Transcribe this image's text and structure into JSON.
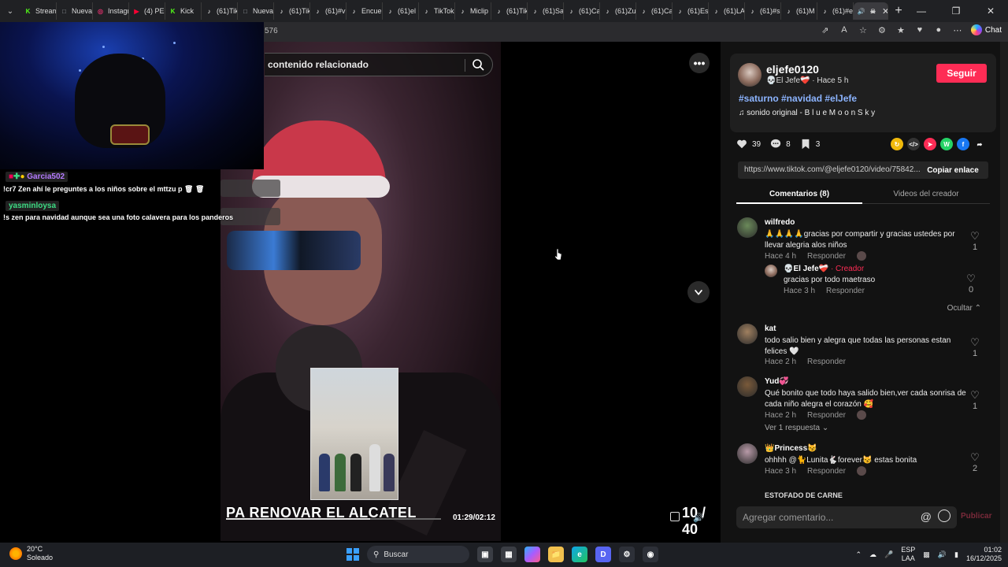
{
  "browser": {
    "tabs": [
      {
        "label": "Stream",
        "icon": "kick-icon",
        "color": "#53fc18"
      },
      {
        "label": "Nueva",
        "icon": "page-icon",
        "color": "#9aa0a6"
      },
      {
        "label": "Instagr",
        "icon": "instagram-icon",
        "color": "#e1306c"
      },
      {
        "label": "(4) PER",
        "icon": "youtube-icon",
        "color": "#ff0033"
      },
      {
        "label": "Kick",
        "icon": "kick-icon",
        "color": "#53fc18"
      },
      {
        "label": "(61)Tik",
        "icon": "tiktok-icon",
        "color": "#ffffff"
      },
      {
        "label": "Nueva",
        "icon": "page-icon",
        "color": "#9aa0a6"
      },
      {
        "label": "(61)Tik",
        "icon": "tiktok-icon",
        "color": "#ffffff"
      },
      {
        "label": "(61)#v",
        "icon": "tiktok-icon",
        "color": "#ffffff"
      },
      {
        "label": "Encue",
        "icon": "tiktok-icon",
        "color": "#ffffff"
      },
      {
        "label": "(61)el",
        "icon": "tiktok-icon",
        "color": "#ffffff"
      },
      {
        "label": "TikTok",
        "icon": "tiktok-icon",
        "color": "#ffffff"
      },
      {
        "label": "Miclip",
        "icon": "tiktok-icon",
        "color": "#ffffff"
      },
      {
        "label": "(61)Tik",
        "icon": "tiktok-icon",
        "color": "#ffffff"
      },
      {
        "label": "(61)Sa",
        "icon": "tiktok-icon",
        "color": "#ffffff"
      },
      {
        "label": "(61)Ca",
        "icon": "tiktok-icon",
        "color": "#ffffff"
      },
      {
        "label": "(61)Zu",
        "icon": "tiktok-icon",
        "color": "#ffffff"
      },
      {
        "label": "(61)Ca",
        "icon": "tiktok-icon",
        "color": "#ffffff"
      },
      {
        "label": "(61)Es",
        "icon": "tiktok-icon",
        "color": "#ffffff"
      },
      {
        "label": "(61)LA",
        "icon": "tiktok-icon",
        "color": "#ffffff"
      },
      {
        "label": "(61)#s",
        "icon": "tiktok-icon",
        "color": "#ffffff"
      },
      {
        "label": "(61)M",
        "icon": "tiktok-icon",
        "color": "#ffffff"
      },
      {
        "label": "(61)#e",
        "icon": "tiktok-icon",
        "color": "#ffffff"
      }
    ],
    "url_fragment": "576",
    "chat_label": "Chat"
  },
  "stream_overlay": {
    "chat": [
      {
        "user": "Garcia502",
        "user_color": "#b57bff",
        "text": "!cr7 Zen ahí le preguntes a los niños sobre el mttzu p 🗑 🗑"
      },
      {
        "user": "yasminloysa",
        "user_color": "#3ddc84",
        "text": "!s zen para navidad aunque sea una foto calavera para los panderos"
      }
    ]
  },
  "video": {
    "search_placeholder": "contenido relacionado",
    "caption": "PA RENOVAR EL ALCATEL",
    "time": "01:29/02:12",
    "progress": 0.67,
    "counter": "10 / 40",
    "overlay_progress": 0.24
  },
  "creator": {
    "handle": "eljefe0120",
    "nickname": "💀El Jefe❤️‍🩹",
    "time_ago": "Hace 5 h",
    "follow_label": "Seguir",
    "hashtags": "#saturno #navidad #elJefe",
    "music": "sonido original - B l u e M o o n S k y"
  },
  "stats": {
    "likes": "39",
    "comments": "8",
    "saves": "3"
  },
  "link": {
    "url": "https://www.tiktok.com/@eljefe0120/video/75842...",
    "copy_label": "Copiar enlace"
  },
  "panel_tabs": {
    "comments": "Comentarios (8)",
    "creator_videos": "Videos del creador"
  },
  "comments": [
    {
      "user": "wilfredo",
      "text": "🙏🙏🙏🙏gracias por compartir y gracias ustedes por llevar alegria alos niños",
      "time": "Hace 4 h",
      "reply_label": "Responder",
      "likes": "1",
      "avatar_color": "#6b8a5a"
    },
    {
      "user": "kat",
      "text": "todo salio bien y alegra que todas las personas estan felices 🤍",
      "time": "Hace 2 h",
      "reply_label": "Responder",
      "likes": "1",
      "avatar_color": "#a08060"
    },
    {
      "user": "Yud💞",
      "text": "Qué bonito que todo haya salido bien,ver cada sonrisa de cada niño alegra el corazón 🥰",
      "time": "Hace 2 h",
      "reply_label": "Responder",
      "likes": "1",
      "avatar_color": "#7a5a3a"
    },
    {
      "user": "👑Princess😼",
      "text": "ohhhh @🐈Lunita🐇forever😼 estas bonita",
      "time": "Hace 3 h",
      "reply_label": "Responder",
      "likes": "2",
      "avatar_color": "#b89aa8"
    }
  ],
  "creator_reply": {
    "user": "💀El Jefe❤️‍🩹",
    "tag": "· Creador",
    "text": "gracias por todo maetraso",
    "time": "Hace 3 h",
    "reply_label": "Responder",
    "likes": "0"
  },
  "hide_label": "Ocultar",
  "view_replies_label": "Ver 1 respuesta",
  "cut_off_name": "ESTOFADO DE CARNE",
  "composer": {
    "placeholder": "Agregar comentario...",
    "at_symbol": "@",
    "publish_label": "Publicar"
  },
  "taskbar": {
    "temperature": "20°C",
    "condition": "Soleado",
    "search_label": "Buscar",
    "lang_1": "ESP",
    "lang_2": "LAA",
    "time": "01:02",
    "date": "16/12/2025"
  },
  "colors": {
    "accent": "#fe2c55",
    "hashtag": "#8cb4ff",
    "overlay_border": "#2bd83a"
  }
}
